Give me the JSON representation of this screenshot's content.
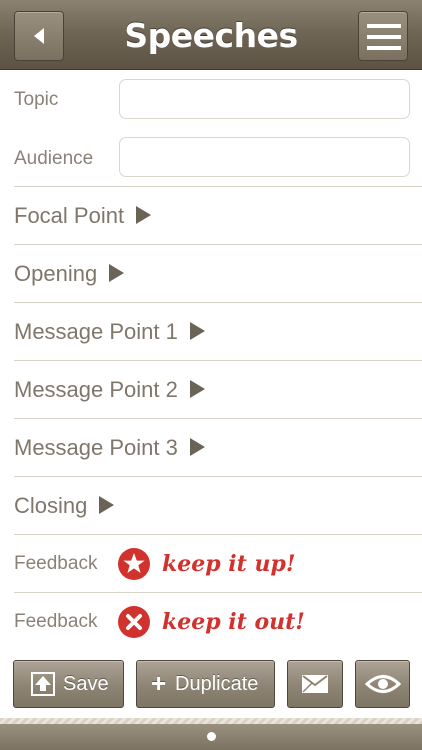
{
  "header": {
    "title": "Speeches",
    "back_icon": "back-triangle-icon",
    "menu_icon": "hamburger-menu-icon"
  },
  "form": {
    "topic": {
      "label": "Topic",
      "value": "",
      "placeholder": ""
    },
    "audience": {
      "label": "Audience",
      "value": "",
      "placeholder": ""
    }
  },
  "sections": [
    {
      "label": "Focal Point"
    },
    {
      "label": "Opening"
    },
    {
      "label": "Message Point 1"
    },
    {
      "label": "Message Point 2"
    },
    {
      "label": "Message Point 3"
    },
    {
      "label": "Closing"
    }
  ],
  "feedback": [
    {
      "label": "Feedback",
      "text": "keep it up!",
      "icon": "star-badge-icon"
    },
    {
      "label": "Feedback",
      "text": "keep it out!",
      "icon": "x-badge-icon"
    }
  ],
  "toolbar": {
    "save_label": "Save",
    "duplicate_label": "Duplicate",
    "duplicate_prefix": "+"
  },
  "colors": {
    "header": "#6e6454",
    "feedback_red": "#d2322d",
    "section_text": "#7f776b"
  },
  "pager": {
    "pages": 1,
    "current": 1
  }
}
